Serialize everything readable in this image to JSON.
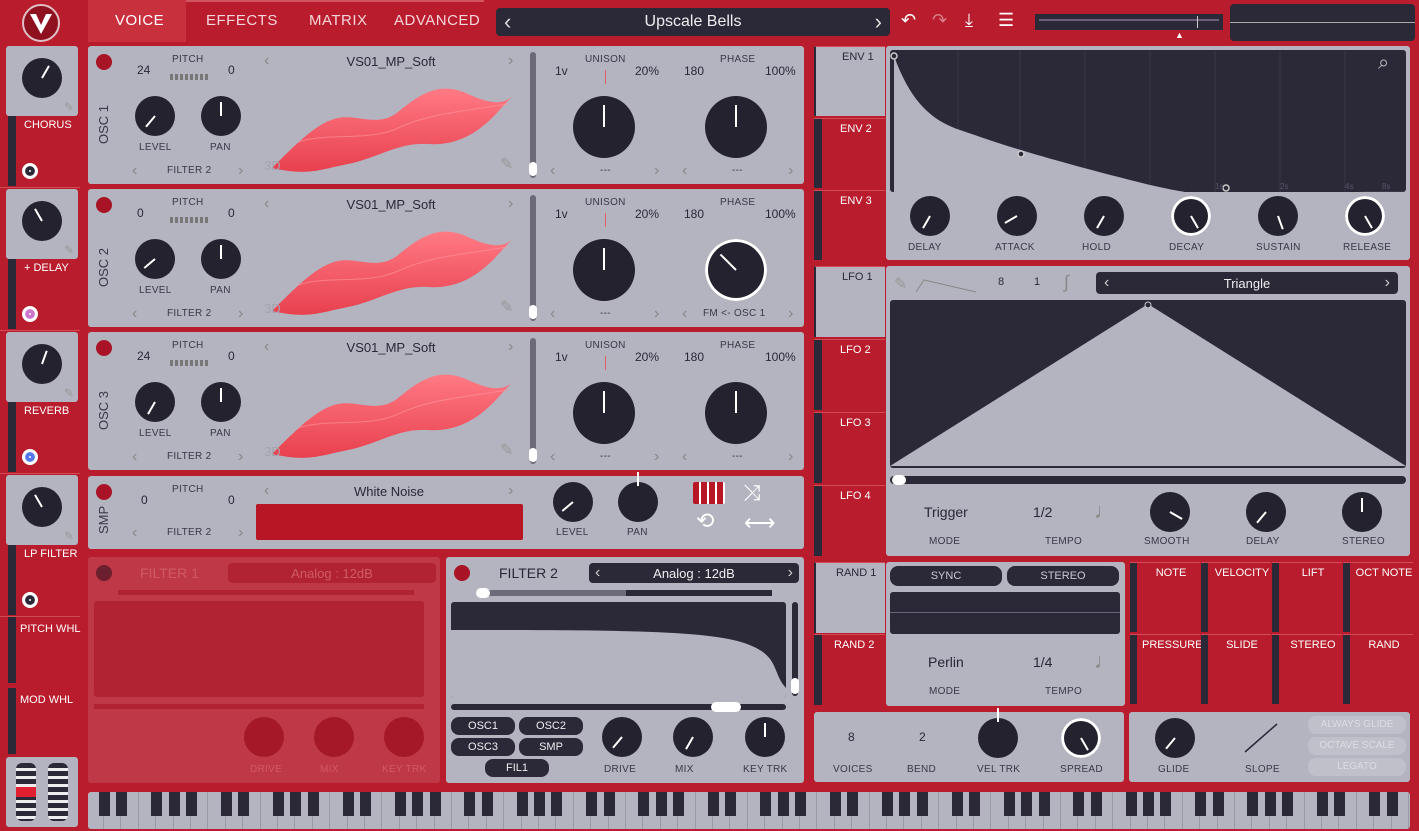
{
  "nav": {
    "tabs": [
      "VOICE",
      "EFFECTS",
      "MATRIX",
      "ADVANCED"
    ],
    "preset_name": "Upscale Bells",
    "preset_prev": "‹",
    "preset_next": "›"
  },
  "fx_sidebar": {
    "items": [
      {
        "label": "CHORUS",
        "dot": "#2b2838"
      },
      {
        "label": "+ DELAY",
        "dot": "#cc77cc"
      },
      {
        "label": "REVERB",
        "dot": "#5577ee"
      },
      {
        "label": "LP FILTER",
        "dot": "#2b2838"
      },
      {
        "label": "PITCH WHL"
      },
      {
        "label": "MOD WHL"
      }
    ]
  },
  "oscillators": [
    {
      "name": "OSC 1",
      "pitch_left": "24",
      "pitch_label": "PITCH",
      "pitch_right": "0",
      "wave": "VS01_MP_Soft",
      "level": "LEVEL",
      "pan": "PAN",
      "dest": "FILTER 2",
      "unison_voices": "1v",
      "unison_label": "UNISON",
      "unison_pct": "20%",
      "phase_val": "180",
      "phase_label": "PHASE",
      "phase_pct": "100%",
      "unison_sub": "---",
      "phase_sub": "---",
      "view3d": "3D"
    },
    {
      "name": "OSC 2",
      "pitch_left": "0",
      "pitch_label": "PITCH",
      "pitch_right": "0",
      "wave": "VS01_MP_Soft",
      "level": "LEVEL",
      "pan": "PAN",
      "dest": "FILTER 2",
      "unison_voices": "1v",
      "unison_label": "UNISON",
      "unison_pct": "20%",
      "phase_val": "180",
      "phase_label": "PHASE",
      "phase_pct": "100%",
      "unison_sub": "---",
      "phase_sub": "FM <- OSC 1",
      "view3d": "3D"
    },
    {
      "name": "OSC 3",
      "pitch_left": "24",
      "pitch_label": "PITCH",
      "pitch_right": "0",
      "wave": "VS01_MP_Soft",
      "level": "LEVEL",
      "pan": "PAN",
      "dest": "FILTER 2",
      "unison_voices": "1v",
      "unison_label": "UNISON",
      "unison_pct": "20%",
      "phase_val": "180",
      "phase_label": "PHASE",
      "phase_pct": "100%",
      "unison_sub": "---",
      "phase_sub": "---",
      "view3d": "3D"
    }
  ],
  "smp": {
    "name": "SMP",
    "pitch_left": "0",
    "pitch_label": "PITCH",
    "pitch_right": "0",
    "sample": "White Noise",
    "dest": "FILTER 2",
    "level": "LEVEL",
    "pan": "PAN"
  },
  "filter1": {
    "title": "FILTER 1",
    "model": "Analog : 12dB",
    "knobs": [
      "DRIVE",
      "MIX",
      "KEY TRK"
    ]
  },
  "filter2": {
    "title": "FILTER 2",
    "model": "Analog : 12dB",
    "knobs": [
      "DRIVE",
      "MIX",
      "KEY TRK"
    ],
    "sources": [
      "OSC1",
      "OSC2",
      "OSC3",
      "SMP",
      "FIL1"
    ]
  },
  "env": {
    "tabs": [
      "ENV 1",
      "ENV 2",
      "ENV 3"
    ],
    "knobs": [
      "DELAY",
      "ATTACK",
      "HOLD",
      "DECAY",
      "SUSTAIN",
      "RELEASE"
    ],
    "grid": [
      "1s",
      "2s",
      "4s",
      "8s"
    ]
  },
  "lfo": {
    "tabs": [
      "LFO 1",
      "LFO 2",
      "LFO 3",
      "LFO 4"
    ],
    "shape": "Triangle",
    "num": "8",
    "den": "1",
    "mode_val": "Trigger",
    "mode_label": "MODE",
    "tempo_val": "1/2",
    "tempo_label": "TEMPO",
    "knobs": [
      "SMOOTH",
      "DELAY",
      "STEREO"
    ]
  },
  "rand": {
    "tabs": [
      "RAND 1",
      "RAND 2"
    ],
    "sync": "SYNC",
    "stereo": "STEREO",
    "mode_val": "Perlin",
    "mode_label": "MODE",
    "tempo_val": "1/4",
    "tempo_label": "TEMPO"
  },
  "mod_sources": [
    "NOTE",
    "VELOCITY",
    "LIFT",
    "OCT NOTE",
    "PRESSURE",
    "SLIDE",
    "STEREO",
    "RAND"
  ],
  "voice": {
    "voices_val": "8",
    "voices": "VOICES",
    "bend_val": "2",
    "bend": "BEND",
    "vel_trk": "VEL TRK",
    "spread": "SPREAD"
  },
  "glide": {
    "glide": "GLIDE",
    "slope": "SLOPE",
    "always_glide": "ALWAYS GLIDE",
    "octave_scale": "OCTAVE SCALE",
    "legato": "LEGATO"
  },
  "colors": {
    "brand": "#b91c2c",
    "panel": "#b3b4bf",
    "dark": "#24222f",
    "wave": "#ff5566"
  }
}
